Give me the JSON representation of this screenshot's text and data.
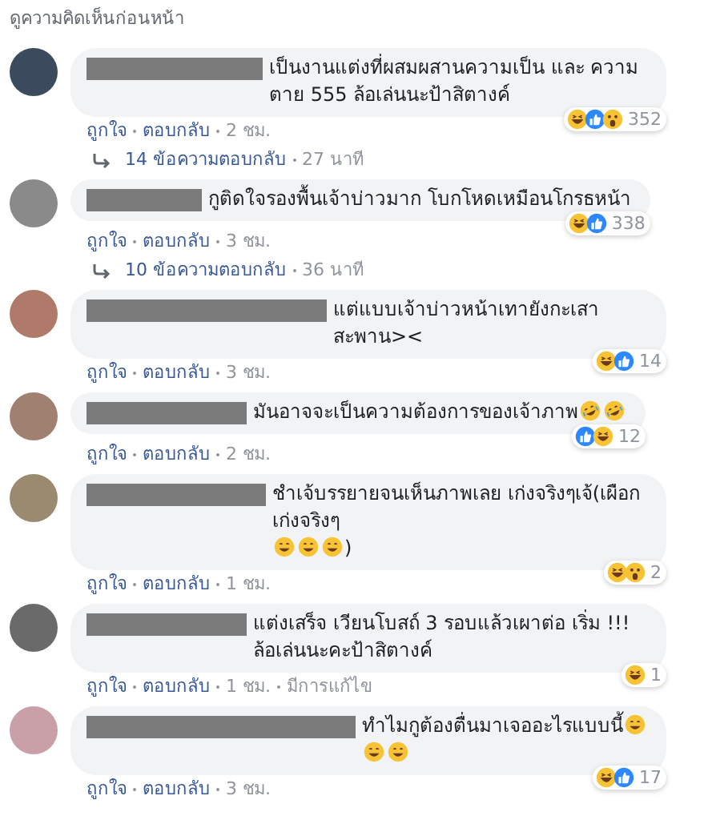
{
  "previous_link": "ดูความคิดเห็นก่อนหน้า",
  "comments": [
    {
      "segments": [
        {
          "kind": "text",
          "text": "เป็นงานแต่งที่ผสมผสานความเป็น และ ความตาย 555 ล้อเล่นนะป้าสิตางค์"
        }
      ],
      "reactions": [
        {
          "kind": "haha"
        },
        {
          "kind": "like"
        },
        {
          "kind": "wow"
        }
      ],
      "reaction_count": "352",
      "meta": [
        {
          "kind": "link",
          "text": "ถูกใจ"
        },
        {
          "kind": "link",
          "text": "ตอบกลับ"
        },
        {
          "kind": "time",
          "text": "2 ชม."
        }
      ],
      "replies": {
        "label": "14 ข้อความตอบกลับ",
        "time": "27 นาที"
      }
    },
    {
      "segments": [
        {
          "kind": "text",
          "text": "กูติดใจรองพื้นเจ้าบ่าวมาก โบกโหดเหมือนโกรธหน้า"
        }
      ],
      "reactions": [
        {
          "kind": "haha"
        },
        {
          "kind": "like"
        }
      ],
      "reaction_count": "338",
      "meta": [
        {
          "kind": "link",
          "text": "ถูกใจ"
        },
        {
          "kind": "link",
          "text": "ตอบกลับ"
        },
        {
          "kind": "time",
          "text": "3 ชม."
        }
      ],
      "replies": {
        "label": "10 ข้อความตอบกลับ",
        "time": "36 นาที"
      }
    },
    {
      "segments": [
        {
          "kind": "text",
          "text": "แต่แบบเจ้าบ่าวหน้าเทายังกะเสาสะพาน><"
        }
      ],
      "reactions": [
        {
          "kind": "haha"
        },
        {
          "kind": "like"
        }
      ],
      "reaction_count": "14",
      "meta": [
        {
          "kind": "link",
          "text": "ถูกใจ"
        },
        {
          "kind": "link",
          "text": "ตอบกลับ"
        },
        {
          "kind": "time",
          "text": "3 ชม."
        }
      ]
    },
    {
      "segments": [
        {
          "kind": "text",
          "text": "มันอาจจะเป็นความต้องการของเจ้าภาพ"
        },
        {
          "kind": "rofl"
        },
        {
          "kind": "rofl"
        }
      ],
      "reactions": [
        {
          "kind": "like"
        },
        {
          "kind": "haha"
        }
      ],
      "reaction_count": "12",
      "meta": [
        {
          "kind": "link",
          "text": "ถูกใจ"
        },
        {
          "kind": "link",
          "text": "ตอบกลับ"
        },
        {
          "kind": "time",
          "text": "2 ชม."
        }
      ]
    },
    {
      "segments": [
        {
          "kind": "text",
          "text": "ชำเจ้บรรยายจนเห็นภาพเลย เก่งจริงๆเจ้(เผือก เก่งจริงๆ"
        },
        {
          "kind": "grin"
        },
        {
          "kind": "grin"
        },
        {
          "kind": "grin"
        },
        {
          "kind": "text",
          "text": ")"
        }
      ],
      "reactions": [
        {
          "kind": "haha"
        },
        {
          "kind": "wow"
        }
      ],
      "reaction_count": "2",
      "meta": [
        {
          "kind": "link",
          "text": "ถูกใจ"
        },
        {
          "kind": "link",
          "text": "ตอบกลับ"
        },
        {
          "kind": "time",
          "text": "1 ชม."
        }
      ]
    },
    {
      "segments": [
        {
          "kind": "text",
          "text": "แต่งเสร็จ เวียนโบสถ์ 3 รอบแล้วเผาต่อ เริ่ม !!! ล้อเล่นนะคะป้าสิตางค์"
        }
      ],
      "reactions": [
        {
          "kind": "haha"
        }
      ],
      "reaction_count": "1",
      "meta": [
        {
          "kind": "link",
          "text": "ถูกใจ"
        },
        {
          "kind": "link",
          "text": "ตอบกลับ"
        },
        {
          "kind": "time",
          "text": "1 ชม."
        },
        {
          "kind": "note",
          "text": "มีการแก้ไข"
        }
      ]
    },
    {
      "segments": [
        {
          "kind": "text",
          "text": "ทำไมกูต้องตื่นมาเจออะไรแบบนี้ "
        },
        {
          "kind": "grin"
        },
        {
          "kind": "grin"
        },
        {
          "kind": "grin"
        }
      ],
      "reactions": [
        {
          "kind": "haha"
        },
        {
          "kind": "like"
        }
      ],
      "reaction_count": "17",
      "meta": [
        {
          "kind": "link",
          "text": "ถูกใจ"
        },
        {
          "kind": "link",
          "text": "ตอบกลับ"
        },
        {
          "kind": "time",
          "text": "3 ชม."
        }
      ]
    }
  ]
}
